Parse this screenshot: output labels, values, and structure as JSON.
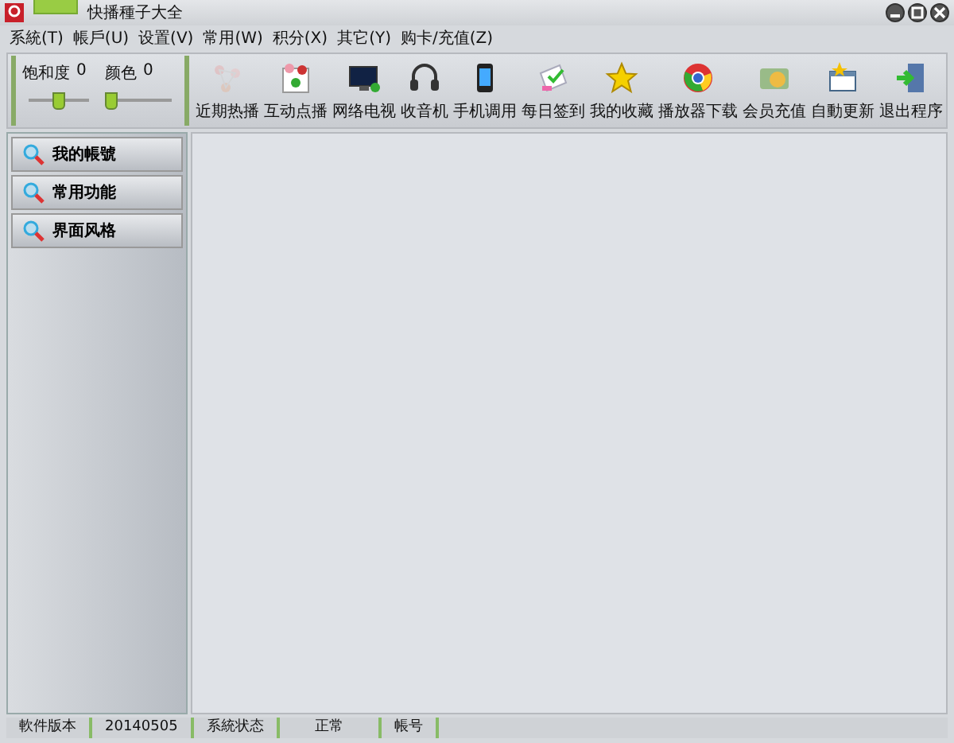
{
  "window": {
    "title": "快播種子大全"
  },
  "menu": [
    "系統(T)",
    "帳戶(U)",
    "设置(V)",
    "常用(W)",
    "积分(X)",
    "其它(Y)",
    "购卡/充值(Z)"
  ],
  "sliders": [
    {
      "label": "饱和度",
      "reading": "0",
      "level": 0.5
    },
    {
      "label": "颜色",
      "reading": "0",
      "level": 0.0
    }
  ],
  "toolbar": [
    {
      "label": "近期热播",
      "kind": "molecule",
      "disabled": true
    },
    {
      "label": "互动点播",
      "kind": "people",
      "disabled": false
    },
    {
      "label": "网络电视",
      "kind": "monitor",
      "disabled": false
    },
    {
      "label": "收音机",
      "kind": "headphones",
      "disabled": false
    },
    {
      "label": "手机调用",
      "kind": "phone",
      "disabled": false
    },
    {
      "label": "每日签到",
      "kind": "calendar",
      "disabled": false
    },
    {
      "label": "我的收藏",
      "kind": "star",
      "disabled": false
    },
    {
      "label": "播放器下载",
      "kind": "globe",
      "disabled": false
    },
    {
      "label": "会员充值",
      "kind": "money",
      "disabled": false
    }
  ],
  "toolbar_right": [
    {
      "label": "自動更新",
      "kind": "update"
    },
    {
      "label": "退出程序",
      "kind": "exit"
    }
  ],
  "sidebar": {
    "items": [
      "我的帳號",
      "常用功能",
      "界面风格"
    ]
  },
  "status_bar": [
    "軟件版本",
    "20140505",
    "系統状态",
    "正常",
    "帳号"
  ]
}
